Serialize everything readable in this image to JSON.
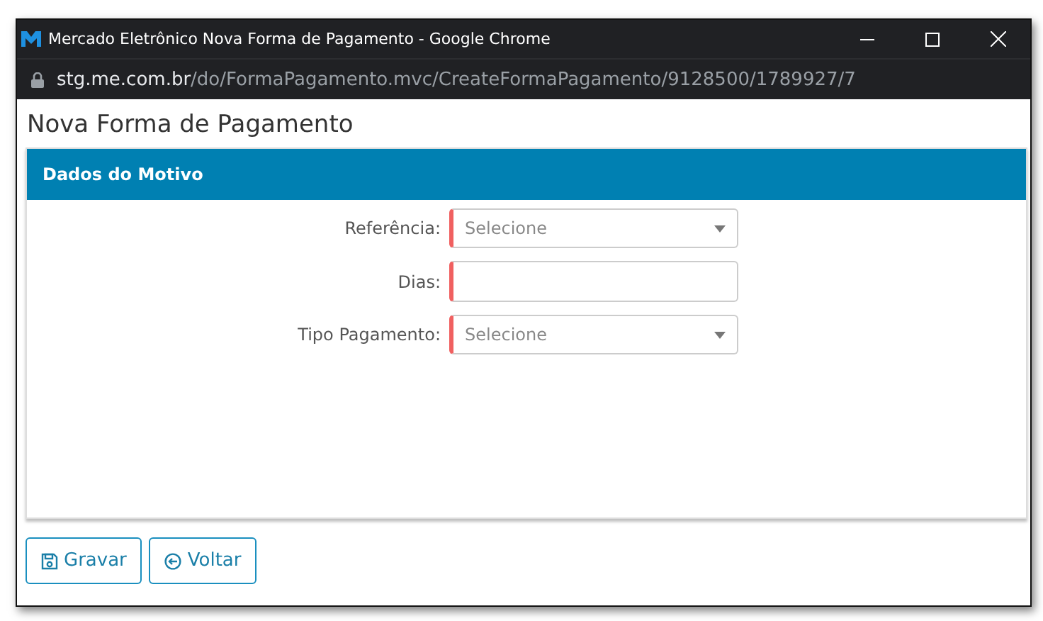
{
  "window": {
    "title": "Mercado Eletrônico Nova Forma de Pagamento - Google Chrome"
  },
  "address": {
    "host": "stg.me.com.br",
    "path": "/do/FormaPagamento.mvc/CreateFormaPagamento/9128500/1789927/7"
  },
  "page_title": "Nova Forma de Pagamento",
  "panel": {
    "title": "Dados do Motivo",
    "fields": [
      {
        "label": "Referência:",
        "kind": "select",
        "placeholder": "Selecione",
        "required": true
      },
      {
        "label": "Dias:",
        "kind": "text",
        "required": true
      },
      {
        "label": "Tipo Pagamento:",
        "kind": "select",
        "placeholder": "Selecione",
        "required": true
      }
    ]
  },
  "buttons": [
    {
      "label": "Gravar",
      "kind": "save"
    },
    {
      "label": "Voltar",
      "kind": "back"
    }
  ]
}
